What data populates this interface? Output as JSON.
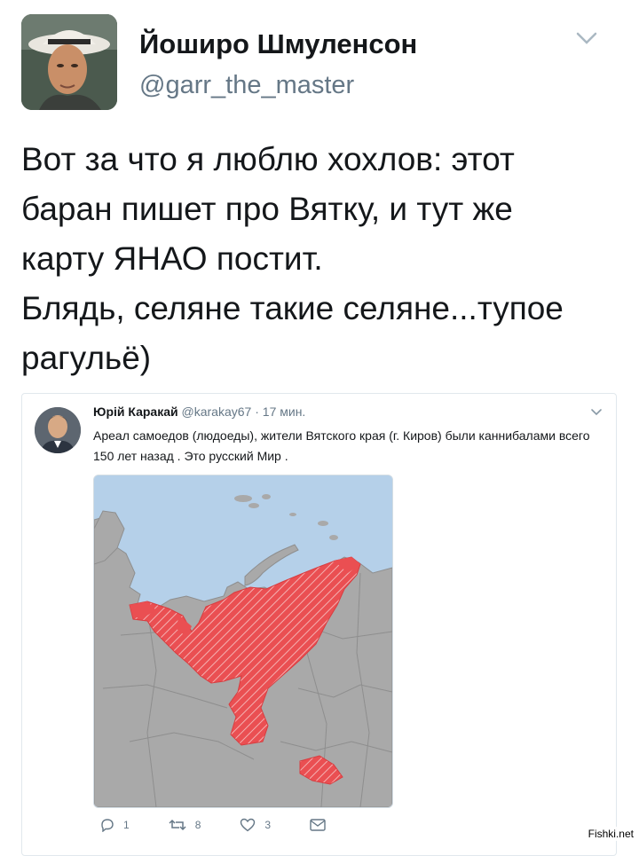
{
  "tweet": {
    "author_name": "Йоширо Шмуленсон",
    "author_handle": "@garr_the_master",
    "text": "Вот за что я люблю хохлов: этот\nбаран пишет про Вятку, и тут же\nкарту ЯНАО постит.\nБлядь, селяне такие селяне...тупое\nрагульё)"
  },
  "quoted": {
    "author_name": "Юрій Каракай",
    "author_handle": "@karakay67",
    "separator": "·",
    "time": "17 мин.",
    "text": "Ареал самоедов (людоеды), жители Вятского края (г. Киров) были каннибалами всего 150 лет назад . Это русский Мир .",
    "actions": {
      "reply_count": "1",
      "retweet_count": "8",
      "like_count": "3"
    }
  },
  "watermark": "Fishki.net",
  "colors": {
    "secondary_text": "#657786",
    "sea": "#b5d0e9",
    "land": "#a9a9a9",
    "highlight": "#ea4f52"
  },
  "icons": [
    "chevron-down-icon",
    "reply-icon",
    "retweet-icon",
    "like-icon",
    "message-icon"
  ]
}
